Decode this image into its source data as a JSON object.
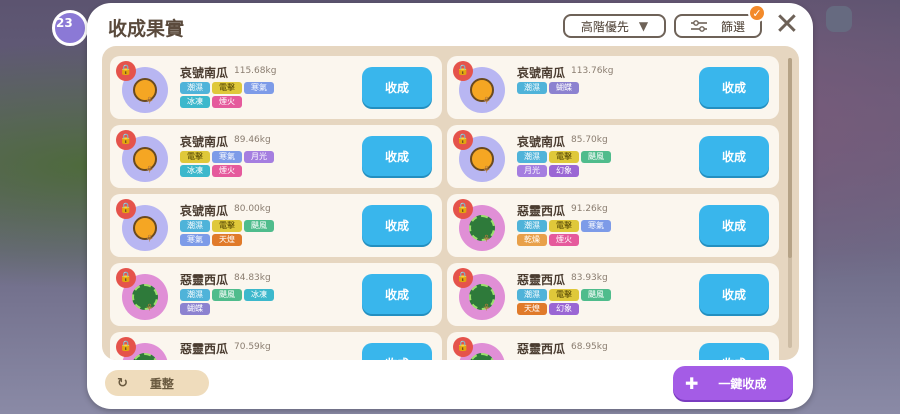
{
  "window": {
    "title": "收成果實"
  },
  "background": {
    "level_badge": "23"
  },
  "toolbar": {
    "sort_label": "高階優先",
    "filter_label": "篩選",
    "filter_badge": "✓",
    "close_label": "✕"
  },
  "items": [
    {
      "name": "哀號南瓜",
      "weight": "115.68kg",
      "type": "pumpkin",
      "tags": [
        "潮濕",
        "電擊",
        "寒氣",
        "冰凍",
        "煙火"
      ],
      "button": "收成"
    },
    {
      "name": "哀號南瓜",
      "weight": "113.76kg",
      "type": "pumpkin",
      "tags": [
        "潮濕",
        "蝴蝶"
      ],
      "button": "收成"
    },
    {
      "name": "哀號南瓜",
      "weight": "89.46kg",
      "type": "pumpkin",
      "tags": [
        "電擊",
        "寒氣",
        "月光",
        "冰凍",
        "煙火"
      ],
      "button": "收成"
    },
    {
      "name": "哀號南瓜",
      "weight": "85.70kg",
      "type": "pumpkin",
      "tags": [
        "潮濕",
        "電擊",
        "颶風",
        "月光",
        "幻象"
      ],
      "button": "收成"
    },
    {
      "name": "哀號南瓜",
      "weight": "80.00kg",
      "type": "pumpkin",
      "tags": [
        "潮濕",
        "電擊",
        "颶風",
        "寒氣",
        "天煌"
      ],
      "button": "收成"
    },
    {
      "name": "惡靈西瓜",
      "weight": "91.26kg",
      "type": "melon",
      "tags": [
        "潮濕",
        "電擊",
        "寒氣",
        "乾燥",
        "煙火"
      ],
      "button": "收成"
    },
    {
      "name": "惡靈西瓜",
      "weight": "84.83kg",
      "type": "melon",
      "tags": [
        "潮濕",
        "颶風",
        "冰凍",
        "蝴蝶"
      ],
      "button": "收成"
    },
    {
      "name": "惡靈西瓜",
      "weight": "83.93kg",
      "type": "melon",
      "tags": [
        "潮濕",
        "電擊",
        "颶風",
        "天煌",
        "幻象"
      ],
      "button": "收成"
    },
    {
      "name": "惡靈西瓜",
      "weight": "70.59kg",
      "type": "melon",
      "tags": [],
      "button": "收成"
    },
    {
      "name": "惡靈西瓜",
      "weight": "68.95kg",
      "type": "melon",
      "tags": [],
      "button": "收成"
    }
  ],
  "footer": {
    "reset_label": "重整",
    "oneclick_label": "一鍵收成"
  },
  "icons": {
    "lock": "lock-icon",
    "sort_arrow": "triangle-down-icon",
    "filter": "sliders-icon",
    "reset": "refresh-icon",
    "plus": "plus-icon"
  }
}
